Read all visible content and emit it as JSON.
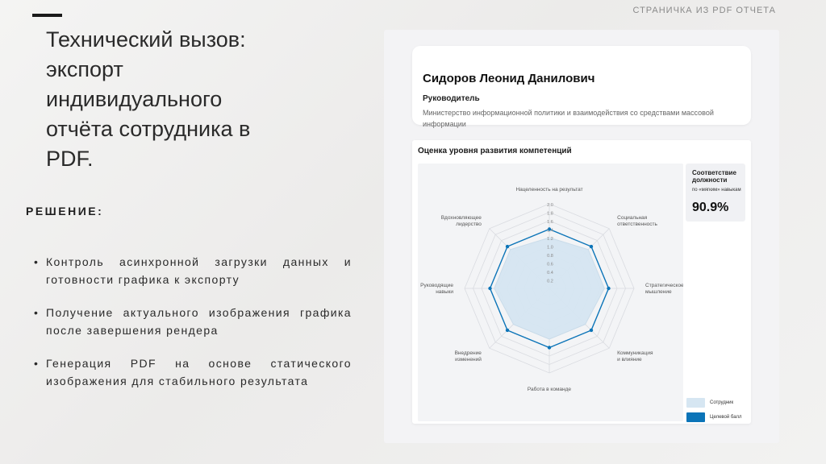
{
  "slide": {
    "top_caption": "СТРАНИЧКА ИЗ PDF ОТЧЕТА",
    "title": "Технический вызов:\nэкспорт\nиндивидуального\nотчёта сотрудника в\nPDF.",
    "solution_heading": "РЕШЕНИЕ:",
    "bullets": [
      "Контроль асинхронной загрузки данных и готовности графика к экспорту",
      "Получение актуального изображения графика после завершения рендера",
      "Генерация PDF на основе статического изображения для стабильного результата"
    ]
  },
  "report": {
    "name": "Сидоров Леонид Данилович",
    "role": "Руководитель",
    "organization": "Министерство информационной политики и взаимодействия со средствами массовой информации",
    "chart_title": "Оценка уровня развития компетенций",
    "match_title": "Соответствие должности",
    "match_subtitle": "по «мягким» навыкам",
    "match_value": "90.9%",
    "legend": [
      {
        "label": "Сотрудник",
        "color": "#d6e6f2"
      },
      {
        "label": "Целевой балл",
        "color": "#0b74b8"
      }
    ]
  },
  "chart_data": {
    "type": "radar",
    "axes": [
      "Нацеленность на результат",
      "Социальная ответственность",
      "Стратегическое мышление",
      "Коммуникация и влияние",
      "Работа в команде",
      "Внедрение изменений",
      "Руководящие навыки",
      "Вдохновляющее лидерство"
    ],
    "axis_labels_lines": [
      [
        "Нацеленность на результат"
      ],
      [
        "Социальная",
        "ответственность"
      ],
      [
        "Стратегическое",
        "мышление"
      ],
      [
        "Коммуникация",
        "и влияние"
      ],
      [
        "Работа в команде"
      ],
      [
        "Внедрение",
        "изменений"
      ],
      [
        "Руководящие",
        "навыки"
      ],
      [
        "Вдохновляющее",
        "лидерство"
      ]
    ],
    "rlim": [
      0,
      2.0
    ],
    "ticks": [
      "2.0",
      "1.8",
      "1.6",
      "1.4",
      "1.2",
      "1.0",
      "0.8",
      "0.6",
      "0.4",
      "0.2"
    ],
    "series": [
      {
        "name": "Сотрудник",
        "values": [
          1.2,
          1.3,
          1.3,
          1.2,
          1.2,
          1.2,
          1.3,
          1.3
        ],
        "color": "#d6e6f2"
      },
      {
        "name": "Целевой балл",
        "values": [
          1.4,
          1.4,
          1.4,
          1.4,
          1.4,
          1.4,
          1.4,
          1.4
        ],
        "color": "#0b74b8"
      }
    ]
  }
}
